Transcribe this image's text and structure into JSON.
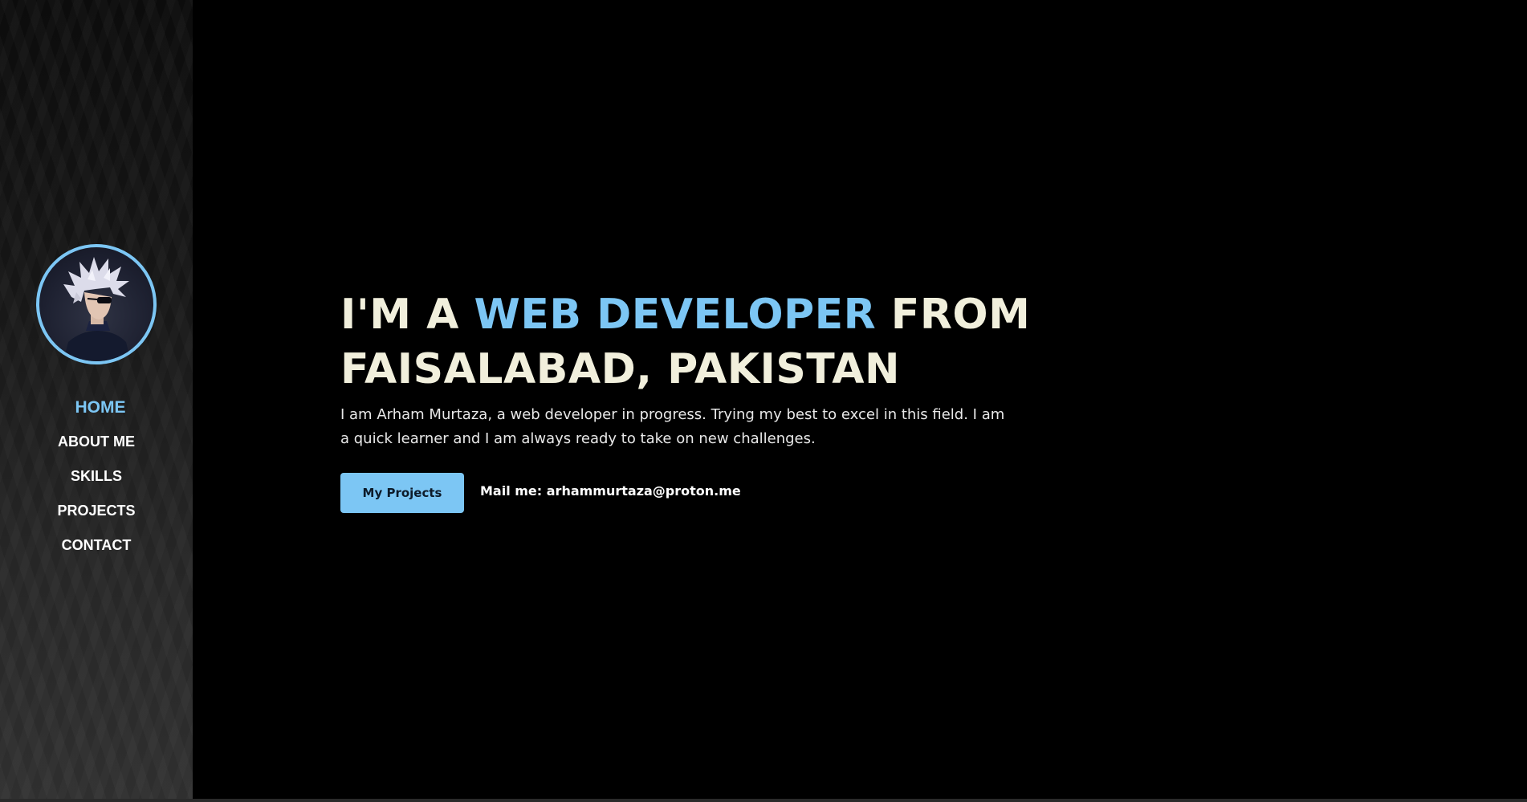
{
  "sidebar": {
    "avatar_icon": "anime-avatar-icon",
    "nav": [
      {
        "label": "HOME",
        "active": true
      },
      {
        "label": "ABOUT ME",
        "active": false
      },
      {
        "label": "SKILLS",
        "active": false
      },
      {
        "label": "PROJECTS",
        "active": false
      },
      {
        "label": "CONTACT",
        "active": false
      }
    ]
  },
  "hero": {
    "headline_prefix": "I'M A ",
    "headline_accent": "WEB DEVELOPER",
    "headline_suffix": " FROM FAISALABAD, PAKISTAN",
    "intro": "I am Arham Murtaza, a web developer in progress. Trying my best to excel in this field. I am a quick learner and I am always ready to take on new challenges.",
    "button_label": "My Projects",
    "mail_text": "Mail me: arhammurtaza@proton.me"
  },
  "colors": {
    "accent": "#7cc6f4",
    "background": "#000000",
    "headline": "#f1efdc"
  }
}
